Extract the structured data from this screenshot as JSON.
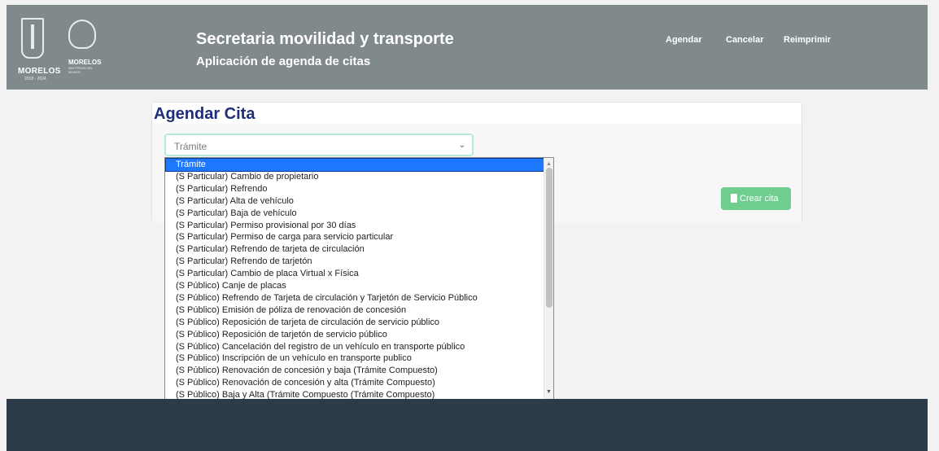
{
  "header": {
    "logo_state_text": "MORELOS",
    "logo_period": "2018 - 2024",
    "logo_brand_text": "MORELOS",
    "logo_brand_tagline": "ANFITRIÓN DEL MUNDO",
    "title": "Secretaria movilidad y transporte",
    "subtitle": "Aplicación de agenda de citas",
    "nav": [
      "Agendar",
      "Cancelar",
      "Reimprimir"
    ]
  },
  "card": {
    "title": "Agendar Cita",
    "select_value": "Trámite",
    "create_button": "Crear cita"
  },
  "dropdown": {
    "selected_index": 0,
    "options": [
      "Trámite",
      "(S Particular) Cambio de propietario",
      "(S Particular) Refrendo",
      "(S Particular) Alta de vehículo",
      "(S Particular) Baja de vehículo",
      "(S Particular) Permiso provisional por 30 días",
      "(S Particular) Permiso de carga para servicio particular",
      "(S Particular) Refrendo de tarjeta de circulación",
      "(S Particular) Refrendo de tarjetón",
      "(S Particular) Cambio de placa Virtual x Física",
      "(S Público) Canje de placas",
      "(S Público) Refrendo de Tarjeta de circulación y Tarjetón de Servicio Público",
      "(S Público) Emisión de póliza de renovación de concesión",
      "(S Público) Reposición de tarjeta de circulación de servicio público",
      "(S Público) Reposición de tarjetón de servicio público",
      "(S Público) Cancelación del registro de un vehículo en transporte público",
      "(S Público) Inscripción de un vehículo en transporte publico",
      "(S Público) Renovación de concesión y baja (Trámite Compuesto)",
      "(S Público) Renovación de concesión y alta (Trámite Compuesto)",
      "(S Público) Baja y Alta (Trámite Compuesto (Trámite Compuesto)"
    ]
  },
  "colors": {
    "header_bg": "#808a8c",
    "title_blue": "#1f2e7a",
    "button_green": "#6fce8e",
    "selected_blue": "#1e78ff",
    "footer_bg": "#2d3a4a"
  }
}
